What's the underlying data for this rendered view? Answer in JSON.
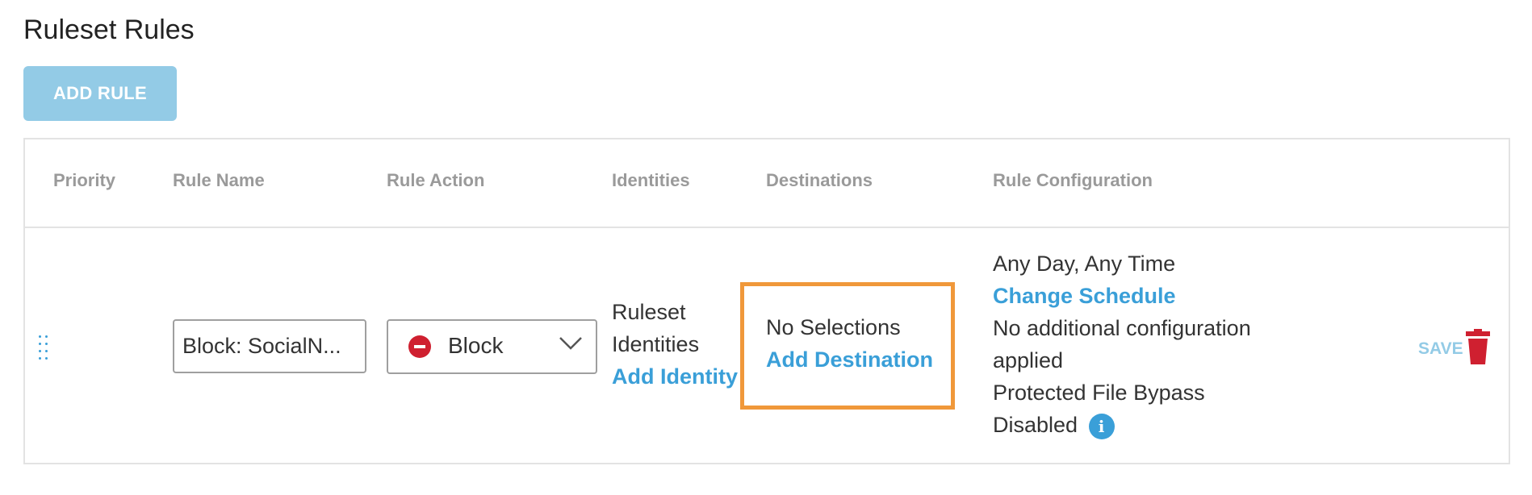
{
  "page": {
    "title": "Ruleset Rules"
  },
  "toolbar": {
    "add_rule_label": "ADD RULE"
  },
  "table": {
    "headers": {
      "priority": "Priority",
      "rule_name": "Rule Name",
      "rule_action": "Rule Action",
      "identities": "Identities",
      "destinations": "Destinations",
      "rule_configuration": "Rule Configuration"
    },
    "rows": [
      {
        "rule_name_value": "Block: SocialN...",
        "rule_action": {
          "label": "Block",
          "icon": "block-icon",
          "color": "#cf2030"
        },
        "identities": {
          "line1": "Ruleset",
          "line2": "Identities",
          "link": "Add Identity"
        },
        "destinations": {
          "text": "No Selections",
          "link": "Add Destination"
        },
        "configuration": {
          "schedule": "Any Day, Any Time",
          "schedule_link": "Change Schedule",
          "extra_line1": "No additional configuration",
          "extra_line2": "applied",
          "bypass_line1": "Protected File Bypass",
          "bypass_line2": "Disabled",
          "info_icon": "info-icon"
        },
        "save_label": "SAVE",
        "delete_icon": "trash-icon"
      }
    ]
  },
  "colors": {
    "accent": "#3a9fd8",
    "button_disabled": "#93cbe6",
    "highlight": "#f0983a",
    "danger": "#cf2030"
  }
}
